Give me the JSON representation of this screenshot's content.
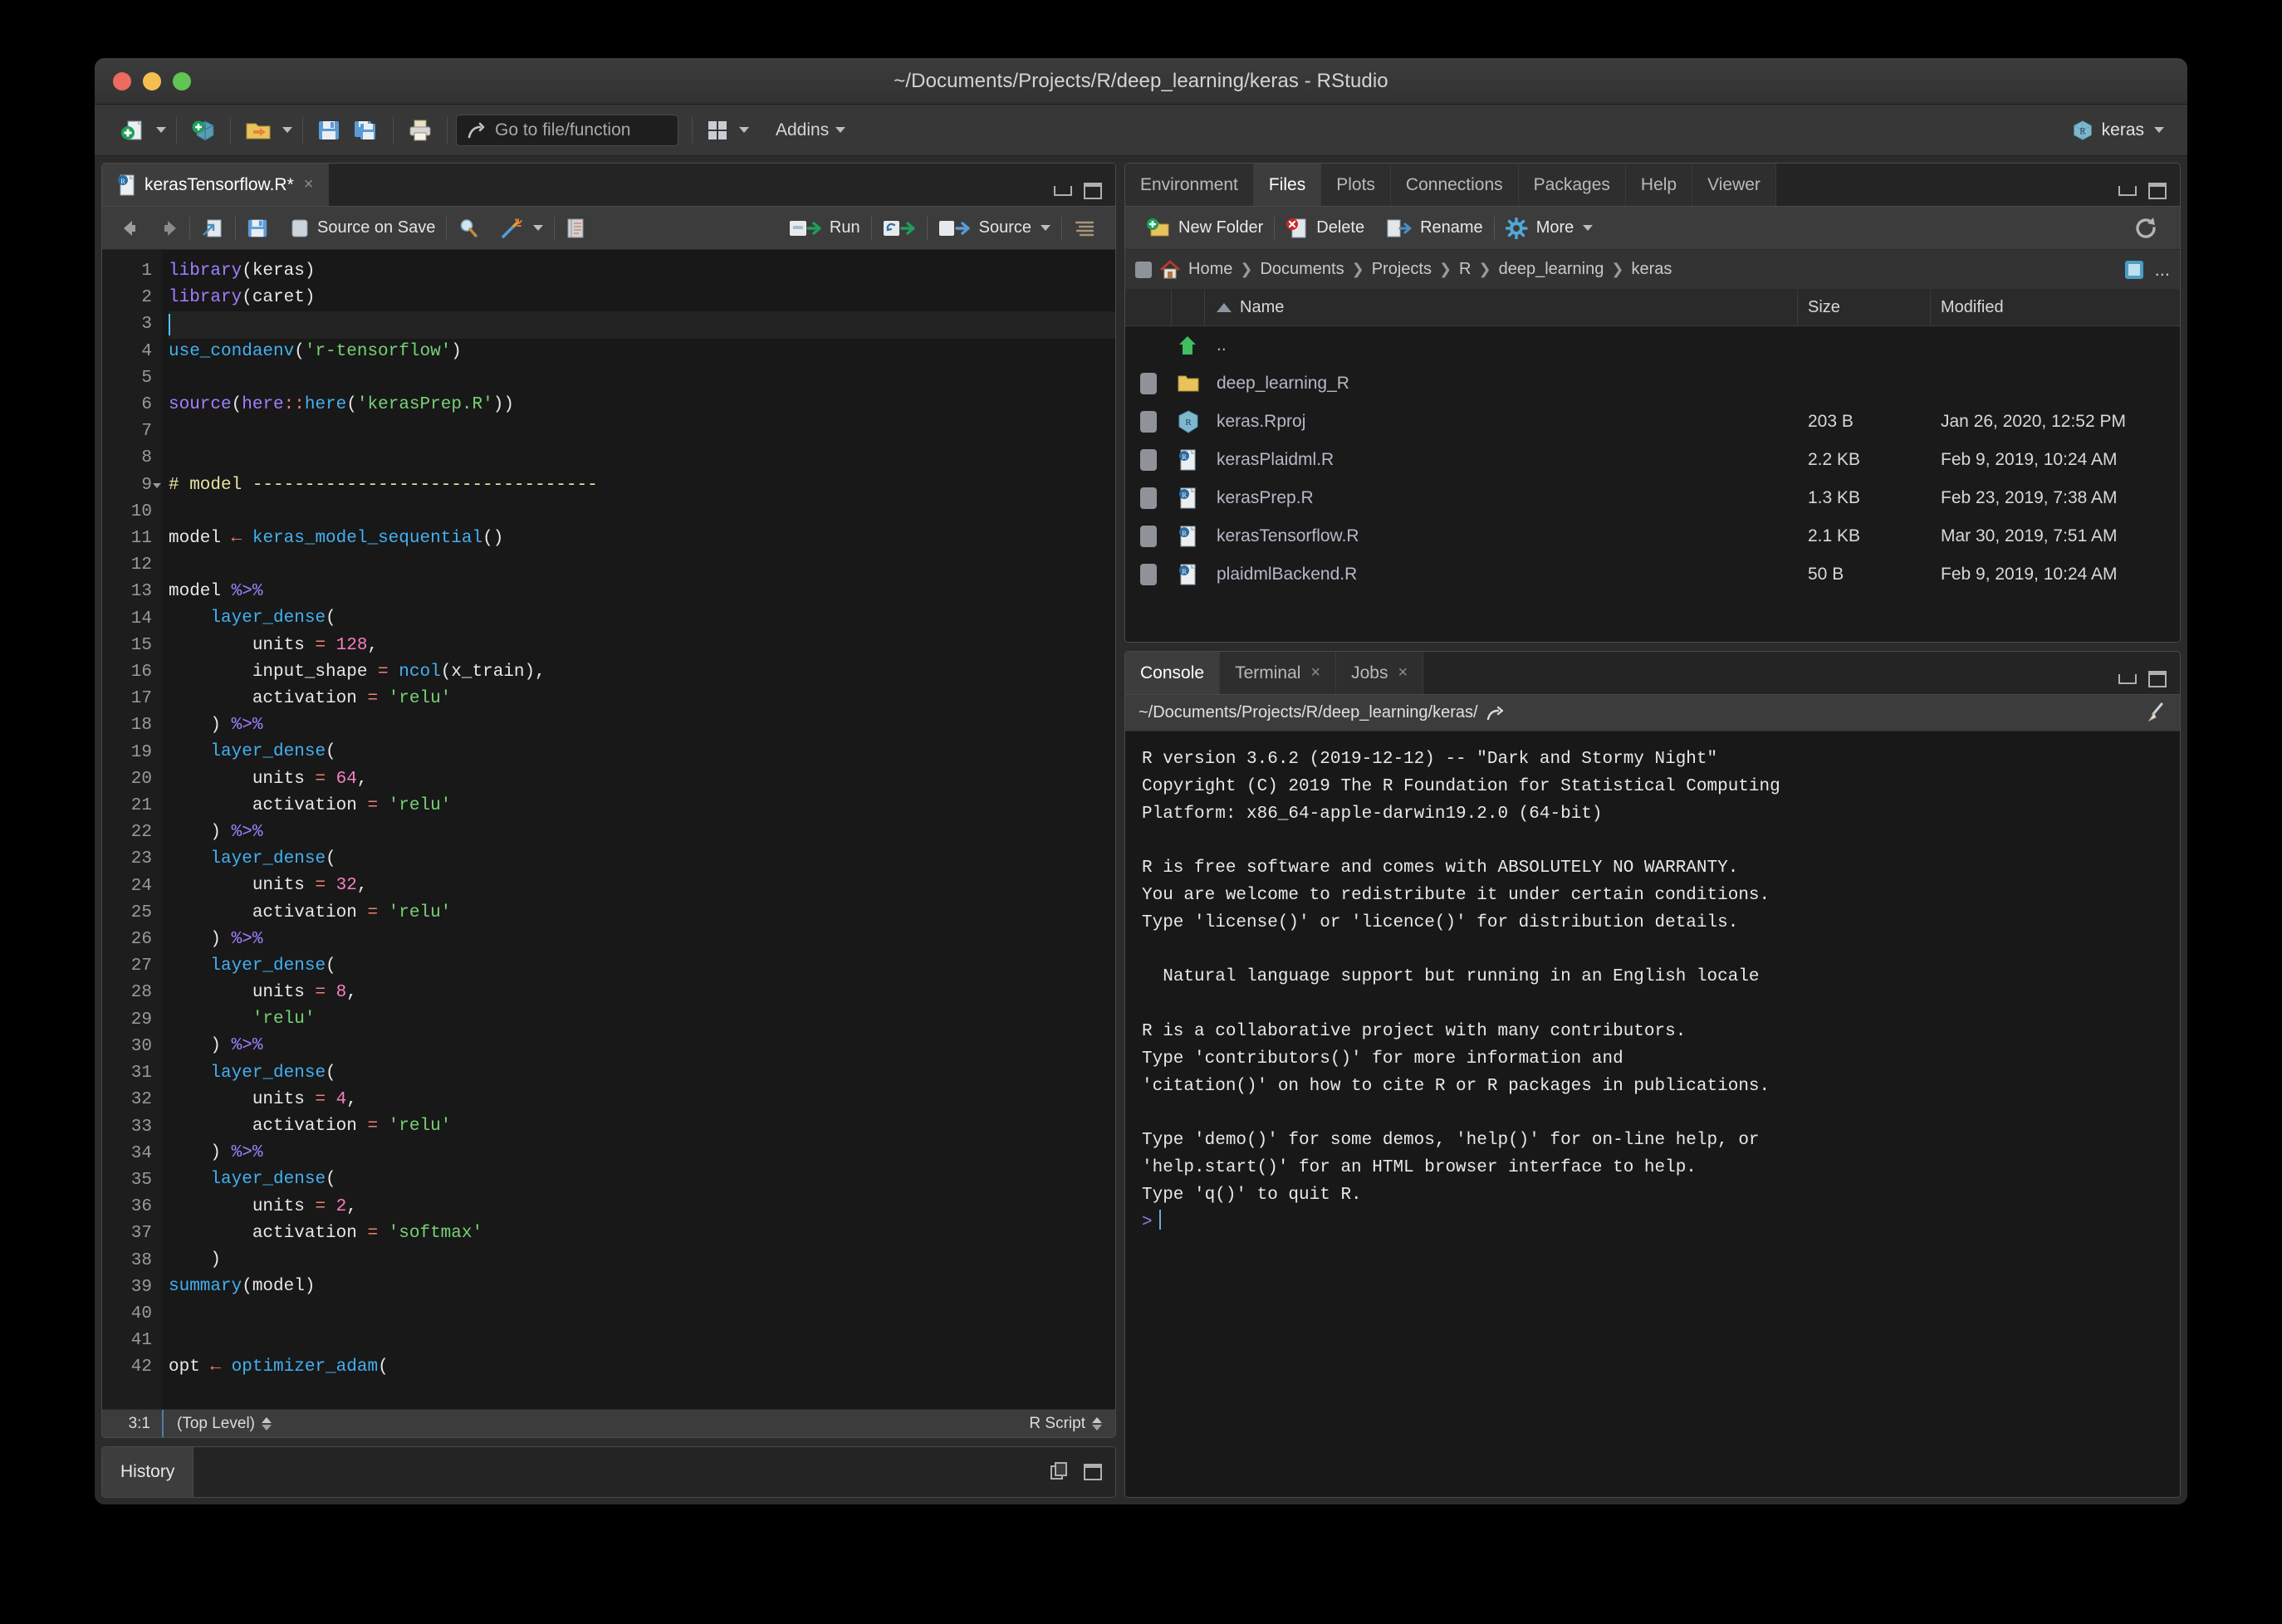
{
  "window": {
    "title": "~/Documents/Projects/R/deep_learning/keras - RStudio"
  },
  "toolbar": {
    "new_file_label": "new-file",
    "new_project_label": "new-project",
    "open_label": "open-file",
    "save_label": "save",
    "save_all_label": "save-all",
    "print_label": "print",
    "goto_placeholder": "Go to file/function",
    "panes_label": "workspace-panes",
    "addins_label": "Addins",
    "project_name": "keras"
  },
  "source": {
    "tab": {
      "label": "kerasTensorflow.R*",
      "close": "×"
    },
    "toolbar": {
      "back": "back",
      "forward": "forward",
      "popout": "show-in-new-window",
      "save": "save",
      "source_on_save_label": "Source on Save",
      "find": "find-replace",
      "magic": "code-tools",
      "compile": "compile-report",
      "run_label": "Run",
      "rerun": "re-run",
      "source_label": "Source",
      "outline": "document-outline"
    },
    "status": {
      "position": "3:1",
      "scope": "(Top Level)",
      "type": "R Script"
    },
    "lines": [
      {
        "n": 1,
        "fold": false,
        "cursor": false,
        "tokens": [
          {
            "t": "kw",
            "v": "library"
          },
          {
            "t": "plain",
            "v": "(keras)"
          }
        ]
      },
      {
        "n": 2,
        "fold": false,
        "cursor": false,
        "tokens": [
          {
            "t": "kw",
            "v": "library"
          },
          {
            "t": "plain",
            "v": "(caret)"
          }
        ]
      },
      {
        "n": 3,
        "fold": false,
        "cursor": true,
        "tokens": []
      },
      {
        "n": 4,
        "fold": false,
        "cursor": false,
        "tokens": [
          {
            "t": "fn",
            "v": "use_condaenv"
          },
          {
            "t": "plain",
            "v": "("
          },
          {
            "t": "str",
            "v": "'r-tensorflow'"
          },
          {
            "t": "plain",
            "v": ")"
          }
        ]
      },
      {
        "n": 5,
        "fold": false,
        "cursor": false,
        "tokens": []
      },
      {
        "n": 6,
        "fold": false,
        "cursor": false,
        "tokens": [
          {
            "t": "kw",
            "v": "source"
          },
          {
            "t": "plain",
            "v": "("
          },
          {
            "t": "kw",
            "v": "here"
          },
          {
            "t": "ns",
            "v": "::"
          },
          {
            "t": "fn",
            "v": "here"
          },
          {
            "t": "plain",
            "v": "("
          },
          {
            "t": "str",
            "v": "'kerasPrep.R'"
          },
          {
            "t": "plain",
            "v": "))"
          }
        ]
      },
      {
        "n": 7,
        "fold": false,
        "cursor": false,
        "tokens": []
      },
      {
        "n": 8,
        "fold": false,
        "cursor": false,
        "tokens": []
      },
      {
        "n": 9,
        "fold": true,
        "cursor": false,
        "tokens": [
          {
            "t": "cmt",
            "v": "# model ---------------------------------"
          }
        ]
      },
      {
        "n": 10,
        "fold": false,
        "cursor": false,
        "tokens": []
      },
      {
        "n": 11,
        "fold": false,
        "cursor": false,
        "tokens": [
          {
            "t": "plain",
            "v": "model "
          },
          {
            "t": "op",
            "v": "←"
          },
          {
            "t": "plain",
            "v": " "
          },
          {
            "t": "fn",
            "v": "keras_model_sequential"
          },
          {
            "t": "plain",
            "v": "()"
          }
        ]
      },
      {
        "n": 12,
        "fold": false,
        "cursor": false,
        "tokens": []
      },
      {
        "n": 13,
        "fold": false,
        "cursor": false,
        "tokens": [
          {
            "t": "plain",
            "v": "model "
          },
          {
            "t": "pipe",
            "v": "%>%"
          }
        ]
      },
      {
        "n": 14,
        "fold": false,
        "cursor": false,
        "tokens": [
          {
            "t": "plain",
            "v": "    "
          },
          {
            "t": "fn",
            "v": "layer_dense"
          },
          {
            "t": "plain",
            "v": "("
          }
        ]
      },
      {
        "n": 15,
        "fold": false,
        "cursor": false,
        "tokens": [
          {
            "t": "plain",
            "v": "        units "
          },
          {
            "t": "op",
            "v": "="
          },
          {
            "t": "plain",
            "v": " "
          },
          {
            "t": "num",
            "v": "128"
          },
          {
            "t": "plain",
            "v": ","
          }
        ]
      },
      {
        "n": 16,
        "fold": false,
        "cursor": false,
        "tokens": [
          {
            "t": "plain",
            "v": "        input_shape "
          },
          {
            "t": "op",
            "v": "="
          },
          {
            "t": "plain",
            "v": " "
          },
          {
            "t": "fn",
            "v": "ncol"
          },
          {
            "t": "plain",
            "v": "(x_train),"
          }
        ]
      },
      {
        "n": 17,
        "fold": false,
        "cursor": false,
        "tokens": [
          {
            "t": "plain",
            "v": "        activation "
          },
          {
            "t": "op",
            "v": "="
          },
          {
            "t": "plain",
            "v": " "
          },
          {
            "t": "str",
            "v": "'relu'"
          }
        ]
      },
      {
        "n": 18,
        "fold": false,
        "cursor": false,
        "tokens": [
          {
            "t": "plain",
            "v": "    ) "
          },
          {
            "t": "pipe",
            "v": "%>%"
          }
        ]
      },
      {
        "n": 19,
        "fold": false,
        "cursor": false,
        "tokens": [
          {
            "t": "plain",
            "v": "    "
          },
          {
            "t": "fn",
            "v": "layer_dense"
          },
          {
            "t": "plain",
            "v": "("
          }
        ]
      },
      {
        "n": 20,
        "fold": false,
        "cursor": false,
        "tokens": [
          {
            "t": "plain",
            "v": "        units "
          },
          {
            "t": "op",
            "v": "="
          },
          {
            "t": "plain",
            "v": " "
          },
          {
            "t": "num",
            "v": "64"
          },
          {
            "t": "plain",
            "v": ","
          }
        ]
      },
      {
        "n": 21,
        "fold": false,
        "cursor": false,
        "tokens": [
          {
            "t": "plain",
            "v": "        activation "
          },
          {
            "t": "op",
            "v": "="
          },
          {
            "t": "plain",
            "v": " "
          },
          {
            "t": "str",
            "v": "'relu'"
          }
        ]
      },
      {
        "n": 22,
        "fold": false,
        "cursor": false,
        "tokens": [
          {
            "t": "plain",
            "v": "    ) "
          },
          {
            "t": "pipe",
            "v": "%>%"
          }
        ]
      },
      {
        "n": 23,
        "fold": false,
        "cursor": false,
        "tokens": [
          {
            "t": "plain",
            "v": "    "
          },
          {
            "t": "fn",
            "v": "layer_dense"
          },
          {
            "t": "plain",
            "v": "("
          }
        ]
      },
      {
        "n": 24,
        "fold": false,
        "cursor": false,
        "tokens": [
          {
            "t": "plain",
            "v": "        units "
          },
          {
            "t": "op",
            "v": "="
          },
          {
            "t": "plain",
            "v": " "
          },
          {
            "t": "num",
            "v": "32"
          },
          {
            "t": "plain",
            "v": ","
          }
        ]
      },
      {
        "n": 25,
        "fold": false,
        "cursor": false,
        "tokens": [
          {
            "t": "plain",
            "v": "        activation "
          },
          {
            "t": "op",
            "v": "="
          },
          {
            "t": "plain",
            "v": " "
          },
          {
            "t": "str",
            "v": "'relu'"
          }
        ]
      },
      {
        "n": 26,
        "fold": false,
        "cursor": false,
        "tokens": [
          {
            "t": "plain",
            "v": "    ) "
          },
          {
            "t": "pipe",
            "v": "%>%"
          }
        ]
      },
      {
        "n": 27,
        "fold": false,
        "cursor": false,
        "tokens": [
          {
            "t": "plain",
            "v": "    "
          },
          {
            "t": "fn",
            "v": "layer_dense"
          },
          {
            "t": "plain",
            "v": "("
          }
        ]
      },
      {
        "n": 28,
        "fold": false,
        "cursor": false,
        "tokens": [
          {
            "t": "plain",
            "v": "        units "
          },
          {
            "t": "op",
            "v": "="
          },
          {
            "t": "plain",
            "v": " "
          },
          {
            "t": "num",
            "v": "8"
          },
          {
            "t": "plain",
            "v": ","
          }
        ]
      },
      {
        "n": 29,
        "fold": false,
        "cursor": false,
        "tokens": [
          {
            "t": "plain",
            "v": "        "
          },
          {
            "t": "str",
            "v": "'relu'"
          }
        ]
      },
      {
        "n": 30,
        "fold": false,
        "cursor": false,
        "tokens": [
          {
            "t": "plain",
            "v": "    ) "
          },
          {
            "t": "pipe",
            "v": "%>%"
          }
        ]
      },
      {
        "n": 31,
        "fold": false,
        "cursor": false,
        "tokens": [
          {
            "t": "plain",
            "v": "    "
          },
          {
            "t": "fn",
            "v": "layer_dense"
          },
          {
            "t": "plain",
            "v": "("
          }
        ]
      },
      {
        "n": 32,
        "fold": false,
        "cursor": false,
        "tokens": [
          {
            "t": "plain",
            "v": "        units "
          },
          {
            "t": "op",
            "v": "="
          },
          {
            "t": "plain",
            "v": " "
          },
          {
            "t": "num",
            "v": "4"
          },
          {
            "t": "plain",
            "v": ","
          }
        ]
      },
      {
        "n": 33,
        "fold": false,
        "cursor": false,
        "tokens": [
          {
            "t": "plain",
            "v": "        activation "
          },
          {
            "t": "op",
            "v": "="
          },
          {
            "t": "plain",
            "v": " "
          },
          {
            "t": "str",
            "v": "'relu'"
          }
        ]
      },
      {
        "n": 34,
        "fold": false,
        "cursor": false,
        "tokens": [
          {
            "t": "plain",
            "v": "    ) "
          },
          {
            "t": "pipe",
            "v": "%>%"
          }
        ]
      },
      {
        "n": 35,
        "fold": false,
        "cursor": false,
        "tokens": [
          {
            "t": "plain",
            "v": "    "
          },
          {
            "t": "fn",
            "v": "layer_dense"
          },
          {
            "t": "plain",
            "v": "("
          }
        ]
      },
      {
        "n": 36,
        "fold": false,
        "cursor": false,
        "tokens": [
          {
            "t": "plain",
            "v": "        units "
          },
          {
            "t": "op",
            "v": "="
          },
          {
            "t": "plain",
            "v": " "
          },
          {
            "t": "num",
            "v": "2"
          },
          {
            "t": "plain",
            "v": ","
          }
        ]
      },
      {
        "n": 37,
        "fold": false,
        "cursor": false,
        "tokens": [
          {
            "t": "plain",
            "v": "        activation "
          },
          {
            "t": "op",
            "v": "="
          },
          {
            "t": "plain",
            "v": " "
          },
          {
            "t": "str",
            "v": "'softmax'"
          }
        ]
      },
      {
        "n": 38,
        "fold": false,
        "cursor": false,
        "tokens": [
          {
            "t": "plain",
            "v": "    )"
          }
        ]
      },
      {
        "n": 39,
        "fold": false,
        "cursor": false,
        "tokens": [
          {
            "t": "fn",
            "v": "summary"
          },
          {
            "t": "plain",
            "v": "(model)"
          }
        ]
      },
      {
        "n": 40,
        "fold": false,
        "cursor": false,
        "tokens": []
      },
      {
        "n": 41,
        "fold": false,
        "cursor": false,
        "tokens": []
      },
      {
        "n": 42,
        "fold": false,
        "cursor": false,
        "tokens": [
          {
            "t": "plain",
            "v": "opt "
          },
          {
            "t": "op",
            "v": "←"
          },
          {
            "t": "plain",
            "v": " "
          },
          {
            "t": "fn",
            "v": "optimizer_adam"
          },
          {
            "t": "plain",
            "v": "("
          }
        ]
      }
    ]
  },
  "history": {
    "tab_label": "History"
  },
  "files_pane": {
    "tabs": [
      {
        "label": "Environment",
        "active": false
      },
      {
        "label": "Files",
        "active": true
      },
      {
        "label": "Plots",
        "active": false
      },
      {
        "label": "Connections",
        "active": false
      },
      {
        "label": "Packages",
        "active": false
      },
      {
        "label": "Help",
        "active": false
      },
      {
        "label": "Viewer",
        "active": false
      }
    ],
    "toolbar": {
      "new_folder": "New Folder",
      "delete": "Delete",
      "rename": "Rename",
      "more": "More",
      "refresh": "refresh"
    },
    "breadcrumb": [
      "Home",
      "Documents",
      "Projects",
      "R",
      "deep_learning",
      "keras"
    ],
    "breadcrumb_overflow": "...",
    "columns": [
      "Name",
      "Size",
      "Modified"
    ],
    "rows": [
      {
        "icon": "up-arrow-icon",
        "name": "..",
        "size": "",
        "modified": "",
        "checkbox": false
      },
      {
        "icon": "folder-icon",
        "name": "deep_learning_R",
        "size": "",
        "modified": "",
        "checkbox": true
      },
      {
        "icon": "rproj-icon",
        "name": "keras.Rproj",
        "size": "203 B",
        "modified": "Jan 26, 2020, 12:52 PM",
        "checkbox": true
      },
      {
        "icon": "rfile-icon",
        "name": "kerasPlaidml.R",
        "size": "2.2 KB",
        "modified": "Feb 9, 2019, 10:24 AM",
        "checkbox": true
      },
      {
        "icon": "rfile-icon",
        "name": "kerasPrep.R",
        "size": "1.3 KB",
        "modified": "Feb 23, 2019, 7:38 AM",
        "checkbox": true
      },
      {
        "icon": "rfile-icon",
        "name": "kerasTensorflow.R",
        "size": "2.1 KB",
        "modified": "Mar 30, 2019, 7:51 AM",
        "checkbox": true
      },
      {
        "icon": "rfile-icon",
        "name": "plaidmlBackend.R",
        "size": "50 B",
        "modified": "Feb 9, 2019, 10:24 AM",
        "checkbox": true
      }
    ]
  },
  "console_pane": {
    "tabs": [
      {
        "label": "Console",
        "active": true,
        "closable": false
      },
      {
        "label": "Terminal",
        "active": false,
        "closable": true
      },
      {
        "label": "Jobs",
        "active": false,
        "closable": true
      }
    ],
    "path": "~/Documents/Projects/R/deep_learning/keras/",
    "output": "R version 3.6.2 (2019-12-12) -- \"Dark and Stormy Night\"\nCopyright (C) 2019 The R Foundation for Statistical Computing\nPlatform: x86_64-apple-darwin19.2.0 (64-bit)\n\nR is free software and comes with ABSOLUTELY NO WARRANTY.\nYou are welcome to redistribute it under certain conditions.\nType 'license()' or 'licence()' for distribution details.\n\n  Natural language support but running in an English locale\n\nR is a collaborative project with many contributors.\nType 'contributors()' for more information and\n'citation()' on how to cite R or R packages in publications.\n\nType 'demo()' for some demos, 'help()' for on-line help, or\n'help.start()' for an HTML browser interface to help.\nType 'q()' to quit R.\n",
    "prompt": ">"
  },
  "colors": {
    "accent_blue": "#43b0f1",
    "string_green": "#76d275",
    "keyword_purple": "#a080ff",
    "number_pink": "#f97fc0",
    "operator_red": "#ef8272",
    "comment_yellow": "#e8e4a0"
  }
}
